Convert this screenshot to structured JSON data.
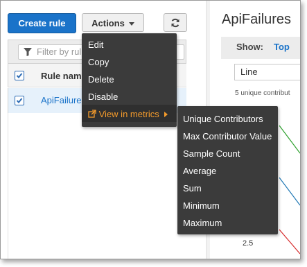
{
  "toolbar": {
    "create_rule": "Create rule",
    "actions": "Actions"
  },
  "filter": {
    "placeholder": "Filter by rul"
  },
  "table": {
    "column_rule_name": "Rule nam",
    "rows": [
      {
        "name": "ApiFailures",
        "checked": true
      }
    ]
  },
  "actions_menu": {
    "items": [
      "Edit",
      "Copy",
      "Delete",
      "Disable"
    ],
    "view_in_metrics": "View in metrics"
  },
  "metrics_submenu": {
    "items": [
      "Unique Contributors",
      "Max Contributor Value",
      "Sample Count",
      "Average",
      "Sum",
      "Minimum",
      "Maximum"
    ]
  },
  "right_panel": {
    "title": "ApiFailures",
    "show_label": "Show:",
    "show_option": "Top",
    "chart_type": "Line",
    "contributors_text": "5 unique contribut",
    "axis_value": "2.5"
  },
  "colors": {
    "primary": "#1a73c9",
    "menu_bg": "#3b3b3b",
    "menu_active": "#f49b2c"
  }
}
